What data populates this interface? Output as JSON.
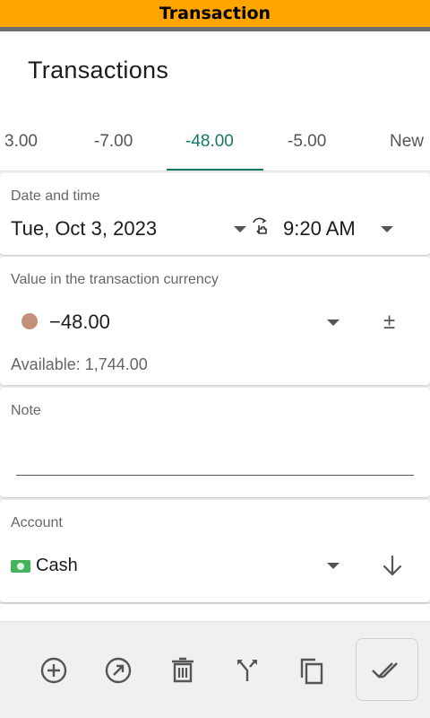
{
  "titlebar": {
    "title": "Transaction"
  },
  "appbar": {
    "title": "Transactions"
  },
  "tabs": [
    {
      "label": "3.00"
    },
    {
      "label": "-7.00"
    },
    {
      "label": "-48.00",
      "active": true
    },
    {
      "label": "-5.00"
    },
    {
      "label": "New"
    }
  ],
  "datetime": {
    "label": "Date and time",
    "date": "Tue, Oct 3, 2023",
    "time": "9:20 AM"
  },
  "value": {
    "label": "Value in the transaction currency",
    "amount": "−48.00",
    "sign_toggle": "±",
    "available": "Available: 1,744.00",
    "dot_color": "#c4907a"
  },
  "note": {
    "label": "Note",
    "value": ""
  },
  "account": {
    "label": "Account",
    "name": "Cash",
    "icon": "cash-banknote-icon"
  },
  "toolbar": {
    "icons": [
      "add-circle-icon",
      "open-arrow-icon",
      "delete-trash-icon",
      "split-merge-icon",
      "copy-icon",
      "double-check-icon"
    ]
  },
  "colors": {
    "accent": "#137a6b",
    "titlebar": "#ffa500"
  }
}
